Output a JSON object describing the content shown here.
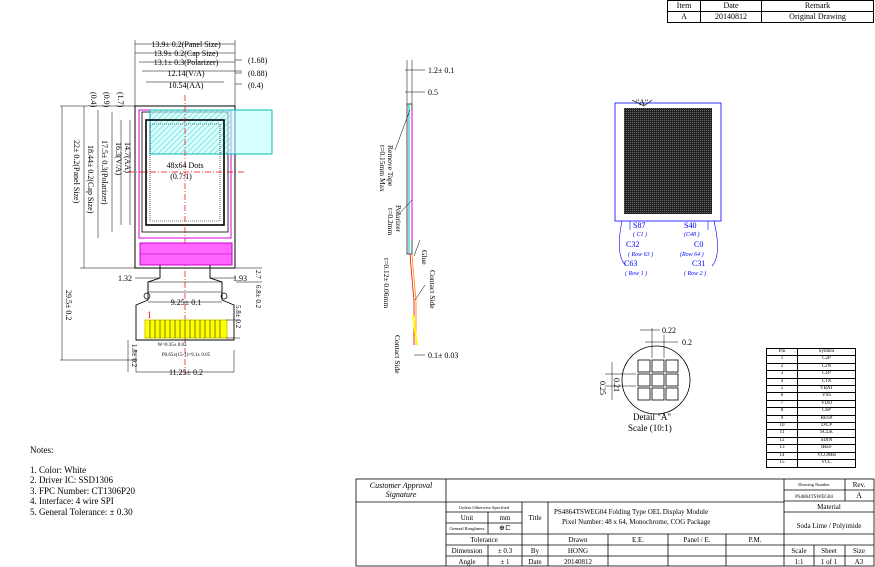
{
  "revision_table": {
    "headers": [
      "Item",
      "Date",
      "Remark"
    ],
    "rows": [
      [
        "A",
        "20140812",
        "Original Drawing"
      ]
    ]
  },
  "front_view": {
    "dims_top": [
      "13.9± 0.2(Panel Size)",
      "13.9± 0.2(Cap Size)",
      "13.1± 0.3(Polarizer)",
      "12.14(V/A)",
      "10.54(AA)"
    ],
    "dims_top_right": [
      "(1.68)",
      "(0.88)",
      "(0.4)"
    ],
    "dims_left": [
      "(1.7)",
      "(0.9)",
      "(0.4)",
      "14.7(AA)",
      "16.3(V/A)",
      "17.5± 0.3(Polarizer)",
      "18.44± 0.2(Cap Size)",
      "22± 0.2(Panel Size)"
    ],
    "center_label": "48x64 Dots",
    "center_sub": "(0.7:1)",
    "dim_left_fpc": "1.32",
    "dim_right_fpc": "1.93",
    "dim_fpc_width": "9.25± 0.1",
    "dim_fpc_right": "6.8± 0.2",
    "dim_fpc_right2": "5.8± 0.2",
    "dim_height_total": "29.5± 0.2",
    "dim_top_small": "2.7",
    "pin_one": "1",
    "pitch_text": "P0.65x(15-1)=9.1± 0.05",
    "w_text": "W=0.35± 0.03",
    "dim_bottom": "11.25± 0.2",
    "dim_bottom_left": "1.8± 0.2"
  },
  "side_view": {
    "dim_top": "1.2± 0.1",
    "dim_second": "0.5",
    "remove_tape": "Remove Tape",
    "remove_tape_sub": "t=0.15mm Max",
    "polarizer": "Polarizer",
    "polarizer_sub": "t=0.2mm",
    "glue": "Glue",
    "contact_side_1": "Contact Side",
    "fpc_thick": "t=0.12± 0.06mm",
    "contact_side_2": "Contact Side",
    "dim_bottom": "0.1± 0.03"
  },
  "matrix_view": {
    "label_a": "\"A\"",
    "s87": "S87",
    "c1": "( C1 )",
    "s40": "S40",
    "c48": "(C48 )",
    "c32": "C32",
    "row63": "( Row 63 )",
    "c0": "C0",
    "row64": "(Row 64 )",
    "c63": "C63",
    "row1": "( Row 1 )",
    "c31": "C31",
    "row2": "( Row 2 )"
  },
  "detail": {
    "dim1": "0.22",
    "dim2": "0.2",
    "dim3": "0.21",
    "dim4": "0.25",
    "title": "Detail \"A\"",
    "scale": "Scale (10:1)"
  },
  "pin_table": {
    "headers": [
      "Pin",
      "Symbol"
    ],
    "rows": [
      [
        "1",
        "C2P"
      ],
      [
        "2",
        "C2N"
      ],
      [
        "3",
        "C1P"
      ],
      [
        "4",
        "C1N"
      ],
      [
        "5",
        "VBAT"
      ],
      [
        "6",
        "VSS"
      ],
      [
        "7",
        "VDD"
      ],
      [
        "8",
        "CS#"
      ],
      [
        "9",
        "RES#"
      ],
      [
        "10",
        "D/C#"
      ],
      [
        "11",
        "SCLK"
      ],
      [
        "12",
        "SDIN"
      ],
      [
        "13",
        "IREF"
      ],
      [
        "14",
        "VCOMH"
      ],
      [
        "15",
        "VCC"
      ]
    ]
  },
  "notes": {
    "title": "Notes:",
    "items": [
      "1. Color: White",
      "2. Driver IC: SSD1306",
      "3. FPC Number: CT1306P20",
      "4. Interface: 4  wire  SPI",
      "5. General Tolerance: ± 0.30"
    ]
  },
  "title_block": {
    "customer_approval": "Customer Approval",
    "signature": "Signature",
    "unless": "Unless Otherwise Specified",
    "unit_label": "Unit",
    "unit_value": "mm",
    "general_roughness": "General Roughness",
    "tolerance": "Tolerance",
    "dimension_label": "Dimension",
    "dimension_value": "± 0.3",
    "angle_label": "Angle",
    "angle_value": "± 1",
    "title_label": "Title",
    "title_line1": "PS4864TSWEG04 Folding Type OEL Display Module",
    "title_line2": "Pixel Number: 48 x 64, Monochrome, COG Package",
    "drawn": "Drawn",
    "ee": "E.E.",
    "panel_e": "Panel / E.",
    "pm": "P.M.",
    "by_label": "By",
    "by_value": "HONG",
    "date_label": "Date",
    "date_value": "20140812",
    "drawing_number_label": "Drawing Number",
    "drawing_number": "PS4864TSWEG04",
    "rev_label": "Rev.",
    "rev_value": "A",
    "material_label": "Material",
    "material_value": "Soda Lime / Polyimide",
    "scale_label": "Scale",
    "scale_value": "1:1",
    "sheet_label": "Sheet",
    "sheet_value": "1 of 1",
    "size_label": "Size",
    "size_value": "A3"
  }
}
